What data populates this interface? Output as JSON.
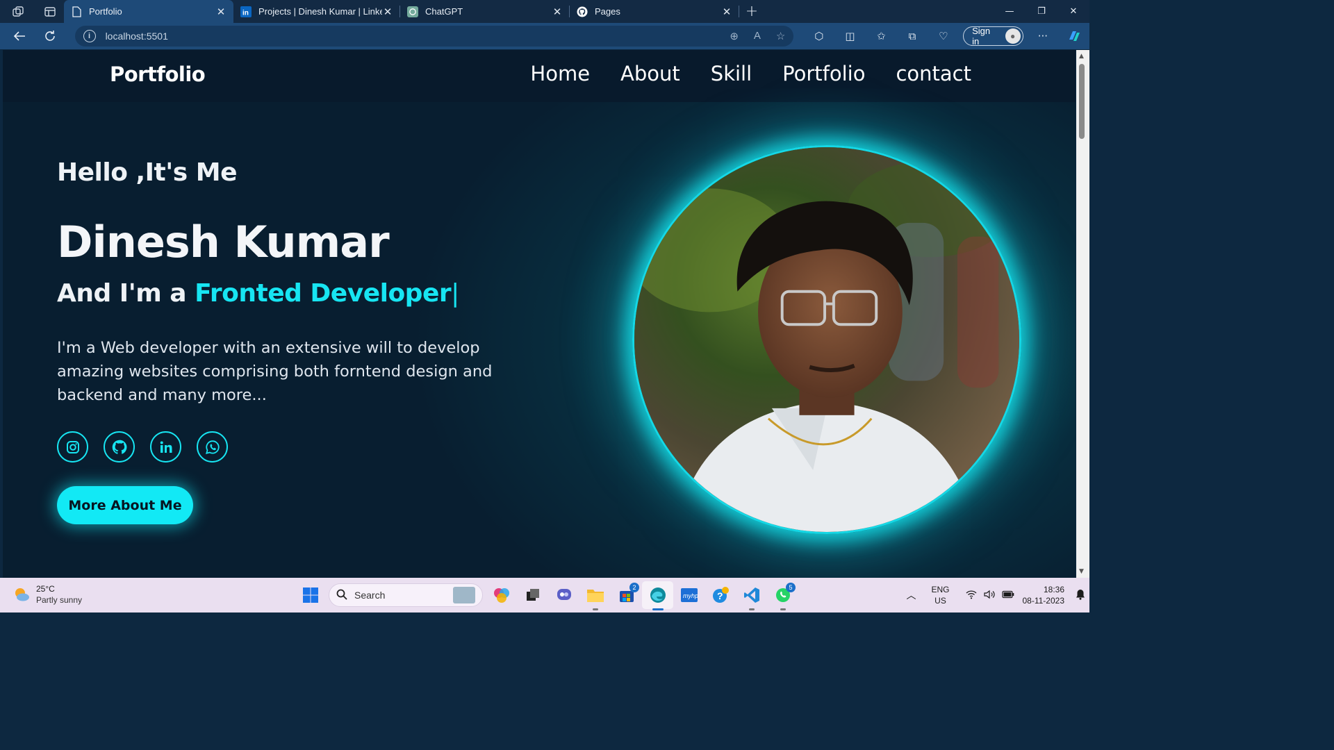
{
  "browser": {
    "tabs": [
      {
        "title": "Portfolio",
        "icon": "page-icon",
        "active": true
      },
      {
        "title": "Projects | Dinesh Kumar | LinkedI",
        "icon": "linkedin-icon",
        "active": false
      },
      {
        "title": "ChatGPT",
        "icon": "chatgpt-icon",
        "active": false
      },
      {
        "title": "Pages",
        "icon": "github-icon",
        "active": false
      }
    ],
    "url": "localhost:5501",
    "sign_in_label": "Sign in"
  },
  "site": {
    "logo": "Portfolio",
    "nav": [
      "Home",
      "About",
      "Skill",
      "Portfolio",
      "contact"
    ],
    "hero": {
      "greeting": "Hello ,It's Me",
      "name": "Dinesh Kumar",
      "role_prefix": "And I'm a ",
      "role_highlight": "Fronted Developer",
      "role_caret": "|",
      "description": "I'm a Web developer with an extensive will to develop amazing websites comprising both forntend design and backend and many more...",
      "socials": [
        "instagram-icon",
        "github-icon",
        "linkedin-icon",
        "whatsapp-icon"
      ],
      "cta_label": "More About Me"
    },
    "colors": {
      "accent": "#17e5f2",
      "header_bg": "#081a2c"
    }
  },
  "taskbar": {
    "weather": {
      "temp": "25°C",
      "condition": "Partly sunny"
    },
    "search_label": "Search",
    "apps": [
      {
        "name": "copilot-icon",
        "badge": ""
      },
      {
        "name": "task-view-icon",
        "badge": ""
      },
      {
        "name": "teams-icon",
        "badge": ""
      },
      {
        "name": "file-explorer-icon",
        "badge": ""
      },
      {
        "name": "store-icon",
        "badge": "2"
      },
      {
        "name": "edge-icon",
        "badge": "",
        "active": true
      },
      {
        "name": "myhp-icon",
        "badge": ""
      },
      {
        "name": "help-icon",
        "badge": ""
      },
      {
        "name": "vscode-icon",
        "badge": ""
      },
      {
        "name": "whatsapp-icon",
        "badge": "5"
      }
    ],
    "lang_line1": "ENG",
    "lang_line2": "US",
    "time": "18:36",
    "date": "08-11-2023"
  }
}
